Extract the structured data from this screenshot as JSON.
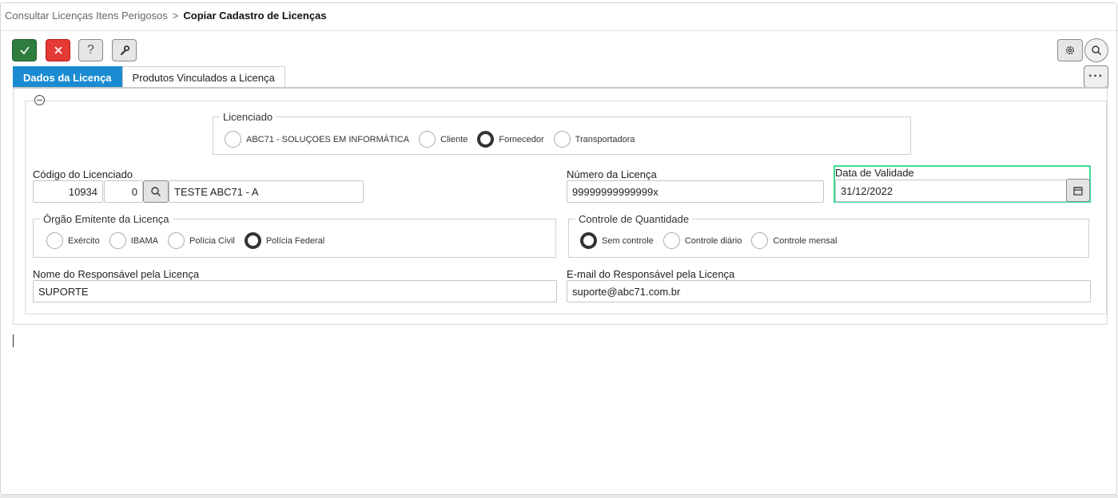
{
  "breadcrumb": {
    "parent": "Consultar Licenças Itens Perigosos",
    "separator": ">",
    "current": "Copiar Cadastro de Licenças"
  },
  "toolbar": {
    "confirm_icon": "check-icon",
    "cancel_icon": "close-icon",
    "help_label": "?",
    "tools_icon": "wrench-icon",
    "settings_icon": "gear-icon",
    "search_icon": "search-icon",
    "more_label": "···"
  },
  "tabs": [
    {
      "label": "Dados da Licença",
      "active": true
    },
    {
      "label": "Produtos Vinculados a Licença",
      "active": false
    }
  ],
  "licenciado": {
    "legend": "Licenciado",
    "options": [
      {
        "label": "ABC71 - SOLUÇOES EM INFORMÁTICA",
        "selected": false
      },
      {
        "label": "Cliente",
        "selected": false
      },
      {
        "label": "Fornecedor",
        "selected": true
      },
      {
        "label": "Transportadora",
        "selected": false
      }
    ]
  },
  "codigo": {
    "label": "Código do Licenciado",
    "code": "10934",
    "sub": "0",
    "name": "TESTE ABC71 - A"
  },
  "numero": {
    "label": "Número da Licença",
    "value": "99999999999999x"
  },
  "validade": {
    "label": "Data de Validade",
    "value": "31/12/2022"
  },
  "orgao": {
    "legend": "Órgão Emitente da Licença",
    "options": [
      {
        "label": "Exército",
        "selected": false
      },
      {
        "label": "IBAMA",
        "selected": false
      },
      {
        "label": "Polícia Civil",
        "selected": false
      },
      {
        "label": "Polícia Federal",
        "selected": true
      }
    ]
  },
  "controle": {
    "legend": "Controle de Quantidade",
    "options": [
      {
        "label": "Sem controle",
        "selected": true
      },
      {
        "label": "Controle diário",
        "selected": false
      },
      {
        "label": "Controle mensal",
        "selected": false
      }
    ]
  },
  "responsavel": {
    "label": "Nome do Responsável pela Licença",
    "value": "SUPORTE"
  },
  "email": {
    "label": "E-mail do Responsável pela Licença",
    "value": "suporte@abc71.com.br"
  },
  "colors": {
    "confirm": "#2e7d3e",
    "cancel": "#e53935",
    "tab_active": "#1b8bd1",
    "focus": "#3ddc97"
  }
}
